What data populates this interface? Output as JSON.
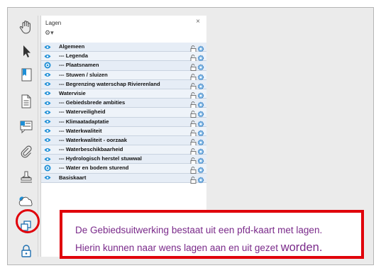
{
  "panel": {
    "title": "Lagen",
    "close_glyph": "×",
    "options_glyph": "⚙▾"
  },
  "layers": [
    {
      "label": "Algemeen",
      "visible": true
    },
    {
      "label": "--- Legenda",
      "visible": true
    },
    {
      "label": "--- Plaatsnamen",
      "visible": false
    },
    {
      "label": "--- Stuwen / sluizen",
      "visible": true
    },
    {
      "label": "--- Begrenzing waterschap Rivierenland",
      "visible": true
    },
    {
      "label": "Watervisie",
      "visible": true
    },
    {
      "label": "--- Gebiedsbrede ambities",
      "visible": true
    },
    {
      "label": "--- Waterveiligheid",
      "visible": true
    },
    {
      "label": "--- Klimaatadaptatie",
      "visible": true
    },
    {
      "label": "--- Waterkwaliteit",
      "visible": true
    },
    {
      "label": "--- Waterkwaliteit - oorzaak",
      "visible": true
    },
    {
      "label": "--- Waterbeschikbaarheid",
      "visible": true
    },
    {
      "label": "--- Hydrologisch herstel stuwwal",
      "visible": true
    },
    {
      "label": "--- Water en bodem sturend",
      "visible": false
    },
    {
      "label": "Basiskaart",
      "visible": true
    }
  ],
  "tools": [
    {
      "icon": "hand-icon"
    },
    {
      "icon": "select-arrow-icon"
    },
    {
      "icon": "bookmark-icon"
    },
    {
      "icon": "page-icon"
    },
    {
      "icon": "comment-icon"
    },
    {
      "icon": "attachment-icon"
    },
    {
      "icon": "signature-icon"
    },
    {
      "icon": "cloud-icon"
    },
    {
      "icon": "layers-icon"
    },
    {
      "icon": "lock-icon"
    }
  ],
  "callout": {
    "line1": "De Gebiedsuitwerking bestaat uit een pfd-kaart met lagen.",
    "line2_prefix": "Hierin kunnen naar wens lagen aan en uit gezet ",
    "line2_big": "worden."
  },
  "colors": {
    "accent_red": "#e0000a",
    "eye_blue": "#1e8fd6",
    "text_purple": "#7a2a8a"
  }
}
